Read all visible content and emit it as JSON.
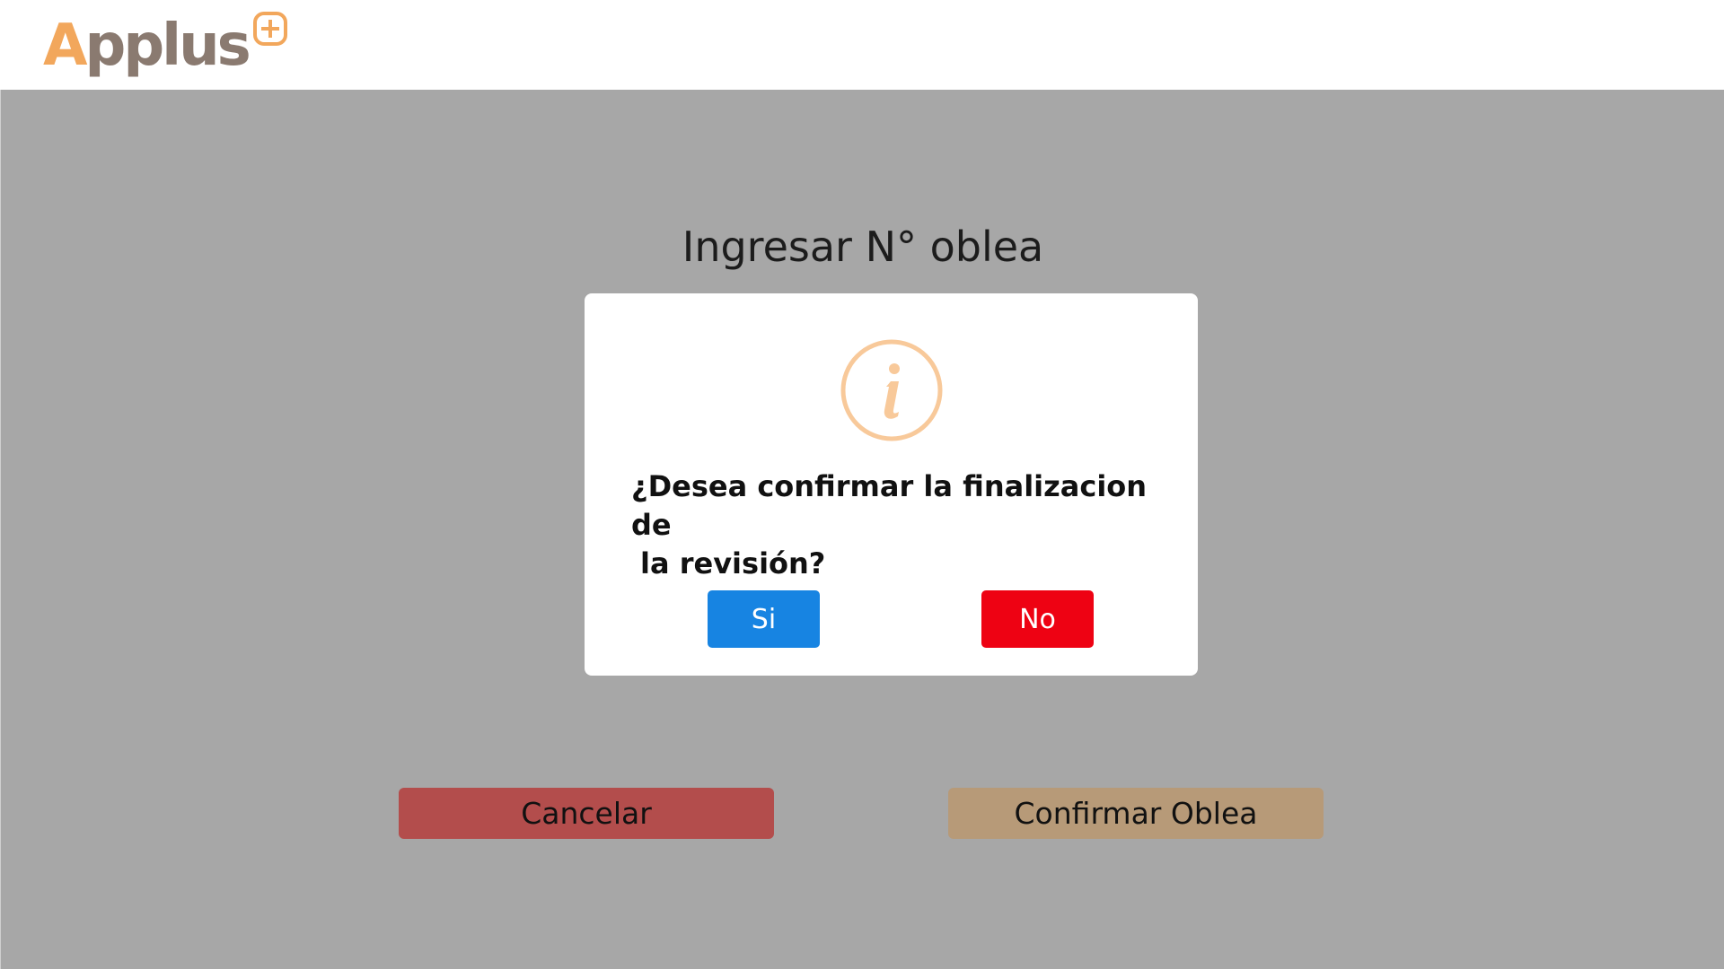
{
  "header": {
    "logo": {
      "text_a": "A",
      "text_rest": "pplus",
      "plus_symbol": "+",
      "icon": "applus-plus-icon"
    }
  },
  "main": {
    "title": "Ingresar N° oblea",
    "cancel_label": "Cancelar",
    "confirm_label": "Confirmar Oblea"
  },
  "modal": {
    "icon": "info-icon",
    "message_line1": "¿Desea confirmar la finalizacion de",
    "message_line2": "la revisión?",
    "yes_label": "Si",
    "no_label": "No"
  },
  "colors": {
    "logo_orange": "#f2a75c",
    "logo_brown": "#8a7a70",
    "overlay_gray": "#a7a7a7",
    "info_icon": "#f8c99a",
    "yes_button": "#1784e2",
    "no_button": "#ee0213",
    "cancel_button": "#b34d4c",
    "confirm_button": "#b79a78"
  }
}
